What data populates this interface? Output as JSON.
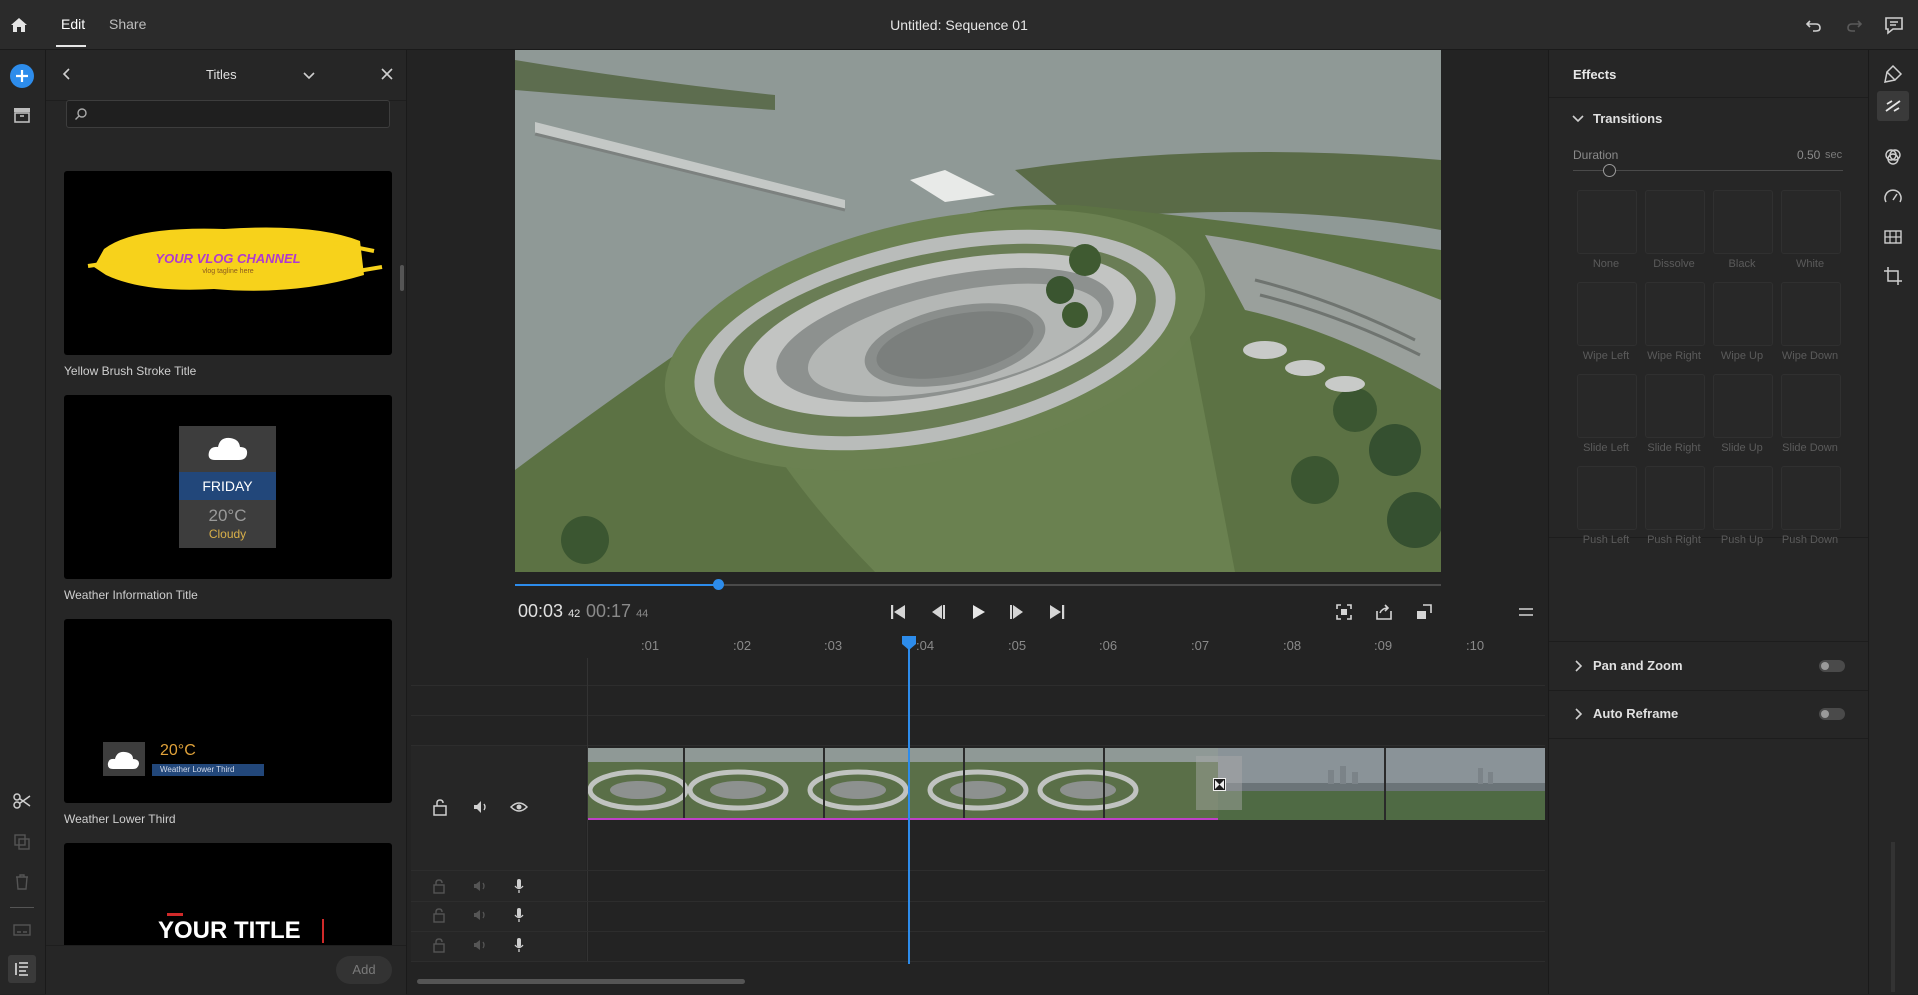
{
  "topbar": {
    "tabs": [
      {
        "label": "Edit",
        "active": true
      },
      {
        "label": "Share",
        "active": false
      }
    ],
    "sequence_title": "Untitled: Sequence 01"
  },
  "titles_panel": {
    "title": "Titles",
    "search_placeholder": "",
    "items": [
      {
        "label": "Yellow Brush Stroke Title",
        "thumb_text": "YOUR VLOG CHANNEL",
        "thumb_subtext": "vlog tagline here"
      },
      {
        "label": "Weather Information Title",
        "day": "FRIDAY",
        "temp": "20°C",
        "condition": "Cloudy"
      },
      {
        "label": "Weather Lower Third",
        "temp": "20°C",
        "caption": "Weather Lower Third"
      },
      {
        "label": "",
        "thumb_text": "YOUR TITLE"
      }
    ],
    "add_label": "Add"
  },
  "player": {
    "current_time": "00:03",
    "current_frames": "42",
    "total_time": "00:17",
    "total_frames": "44",
    "scrub_progress": 0.22
  },
  "timeline": {
    "ruler": [
      ":01",
      ":02",
      ":03",
      ":04",
      ":05",
      ":06",
      ":07",
      ":08",
      ":09",
      ":10"
    ]
  },
  "effects": {
    "title": "Effects",
    "transitions": {
      "label": "Transitions",
      "duration_label": "Duration",
      "duration_value": "0.50",
      "duration_unit": "sec",
      "items": [
        "None",
        "Dissolve",
        "Black",
        "White",
        "Wipe Left",
        "Wipe Right",
        "Wipe Up",
        "Wipe Down",
        "Slide Left",
        "Slide Right",
        "Slide Up",
        "Slide Down",
        "Push Left",
        "Push Right",
        "Push Up",
        "Push Down"
      ]
    },
    "pan_zoom_label": "Pan and Zoom",
    "auto_reframe_label": "Auto Reframe"
  },
  "colors": {
    "accent": "#2d8ceb",
    "clip_marker": "#c040c8",
    "brush_yellow": "#f7d21b",
    "brush_text": "#b03ad0"
  }
}
